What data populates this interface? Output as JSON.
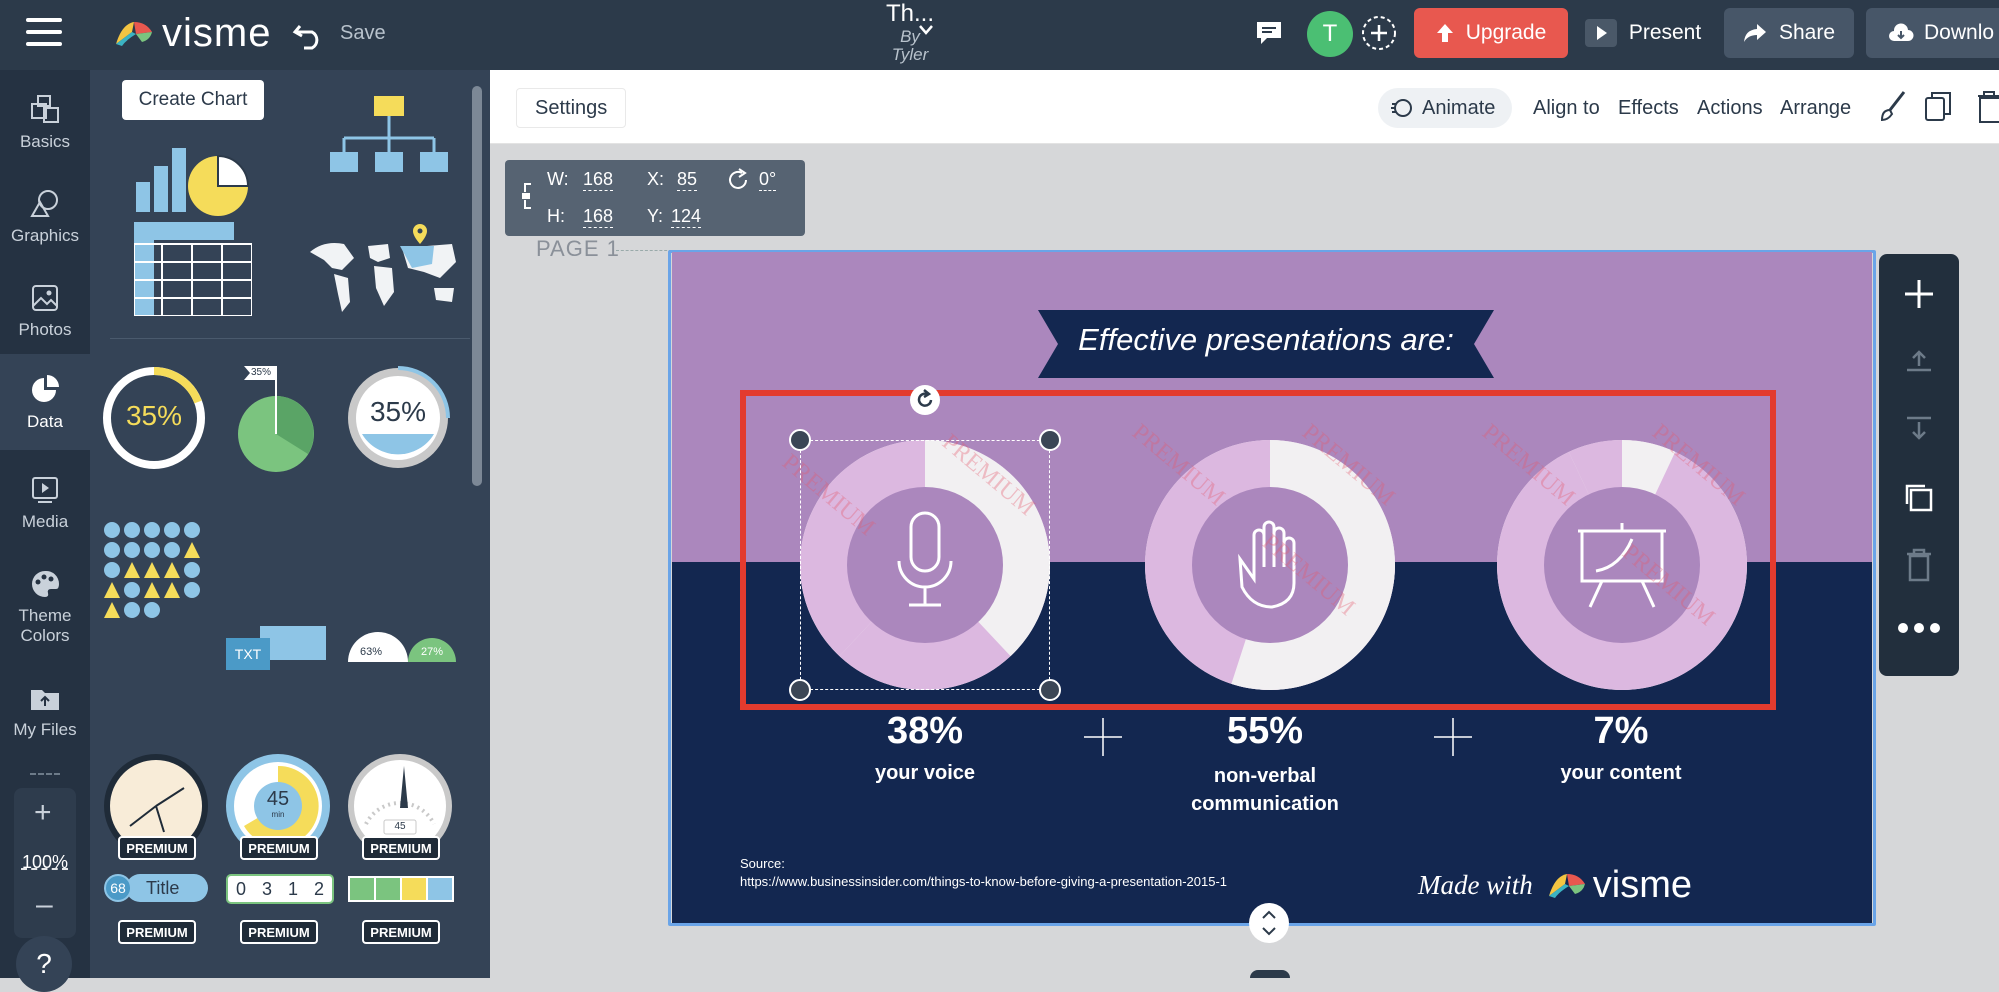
{
  "app": {
    "logo_text": "visme",
    "save_label": "Save",
    "doc_title": "Th...",
    "doc_by": "By",
    "doc_author": "Tyler",
    "avatar_letter": "T",
    "upgrade_label": "Upgrade",
    "present_label": "Present",
    "share_label": "Share",
    "download_label": "Downlo"
  },
  "rail": {
    "items": [
      {
        "label": "Basics",
        "icon": "basics-icon"
      },
      {
        "label": "Graphics",
        "icon": "graphics-icon"
      },
      {
        "label": "Photos",
        "icon": "photos-icon"
      },
      {
        "label": "Data",
        "icon": "data-icon"
      },
      {
        "label": "Media",
        "icon": "media-icon"
      },
      {
        "label": "Theme Colors",
        "icon": "palette-icon"
      },
      {
        "label": "My Files",
        "icon": "files-icon"
      }
    ],
    "zoom": "100%",
    "help": "?"
  },
  "panel": {
    "tooltip": "Create Chart",
    "widget_35a": "35%",
    "widget_35b": "35%",
    "widget_35_flag": "35%",
    "widget_txt": "TXT",
    "widget_63": "63%",
    "widget_27": "27%",
    "gauge_45": "45",
    "gauge_min": "min",
    "speedo_45": "45",
    "counter_68": "68",
    "counter_title": "Title",
    "digits": [
      "0",
      "3",
      "1",
      "2"
    ],
    "premium_label": "PREMIUM"
  },
  "settings": {
    "settings_label": "Settings",
    "animate_label": "Animate",
    "align_label": "Align to",
    "effects_label": "Effects",
    "actions_label": "Actions",
    "arrange_label": "Arrange"
  },
  "dims": {
    "w_label": "W:",
    "w_value": "168",
    "h_label": "H:",
    "h_value": "168",
    "x_label": "X:",
    "x_value": "85",
    "y_label": "Y:",
    "y_value": "124",
    "rotation": "0°"
  },
  "page_label": "PAGE 1",
  "slide": {
    "title": "Effective presentations are:",
    "watermark": "PREMIUM",
    "stats": [
      {
        "value": "38%",
        "label": "your voice",
        "fraction": 0.38
      },
      {
        "value": "55%",
        "label": "non-verbal communication",
        "fraction": 0.55
      },
      {
        "value": "7%",
        "label": "your content",
        "fraction": 0.07
      }
    ],
    "source_label": "Source:",
    "source_url": "https://www.businessinsider.com/things-to-know-before-giving-a-presentation-2015-1",
    "made_with": "Made with",
    "brand": "visme"
  },
  "colors": {
    "topbar": "#2c3a4a",
    "upgrade": "#e8584f",
    "slide_top": "#ab87bd",
    "slide_bottom": "#132750",
    "ring_fill": "#dcb8e0",
    "ring_rest": "#f2f0f2",
    "ring_center": "#ab87bd",
    "highlight": "#e33b2e"
  }
}
